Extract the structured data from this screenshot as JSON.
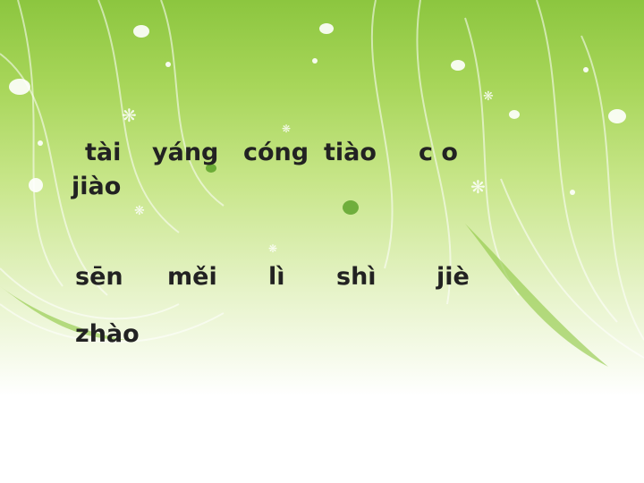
{
  "nav": {
    "left": "",
    "right": ""
  },
  "title": "",
  "row1": {
    "pinyin": [
      "tài",
      "yáng",
      "cóng",
      "tiào",
      "c o",
      "jiào"
    ],
    "chars": [
      "",
      "",
      "",
      "",
      "",
      ""
    ]
  },
  "row2": {
    "pinyin": [
      "sēn",
      "měi",
      "lì",
      "shì",
      "jiè",
      "zhào"
    ],
    "chars": [
      "",
      "",
      "",
      "",
      "",
      ""
    ]
  },
  "colors": {
    "pinyin": "#222222",
    "chars": "#e8361a",
    "bg_top": "#8cc63f"
  }
}
